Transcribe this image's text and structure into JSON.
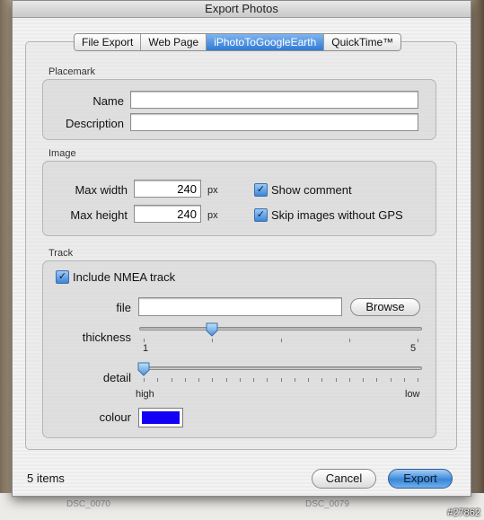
{
  "window": {
    "title": "Export Photos"
  },
  "tabs": [
    {
      "label": "File Export"
    },
    {
      "label": "Web Page"
    },
    {
      "label": "iPhotoToGoogleEarth"
    },
    {
      "label": "QuickTime™"
    }
  ],
  "active_tab": "iPhotoToGoogleEarth",
  "placemark": {
    "section_label": "Placemark",
    "name_label": "Name",
    "name_value": "",
    "description_label": "Description",
    "description_value": ""
  },
  "image": {
    "section_label": "Image",
    "max_width_label": "Max width",
    "max_width_value": "240",
    "max_height_label": "Max height",
    "max_height_value": "240",
    "unit": "px",
    "show_comment_label": "Show comment",
    "show_comment_checked": true,
    "skip_gps_label": "Skip images without GPS",
    "skip_gps_checked": true
  },
  "track": {
    "section_label": "Track",
    "include_nmea_label": "Include NMEA track",
    "include_nmea_checked": true,
    "file_label": "file",
    "file_value": "",
    "browse_label": "Browse",
    "thickness_label": "thickness",
    "thickness_min": "1",
    "thickness_max": "5",
    "thickness_value": 2,
    "detail_label": "detail",
    "detail_high_label": "high",
    "detail_low_label": "low",
    "detail_value": 0,
    "colour_label": "colour",
    "colour_value": "#1400f5"
  },
  "footer": {
    "item_count": "5 items",
    "cancel_label": "Cancel",
    "export_label": "Export"
  },
  "backdrop": {
    "left_caption": "DSC_0070",
    "right_caption": "DSC_0079",
    "watermark": "#27862"
  }
}
